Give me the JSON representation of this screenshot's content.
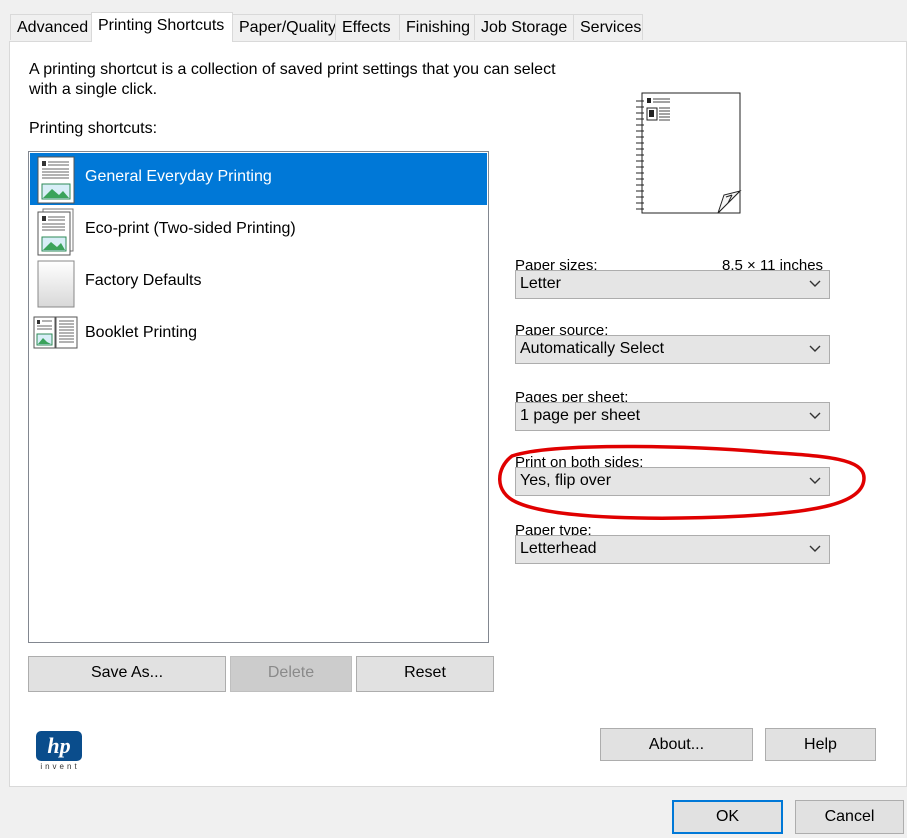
{
  "tabs": [
    "Advanced",
    "Printing Shortcuts",
    "Paper/Quality",
    "Effects",
    "Finishing",
    "Job Storage",
    "Services"
  ],
  "description": "A printing shortcut is a collection of saved print settings that you can select with a single click.",
  "shortcuts_label": "Printing shortcuts:",
  "shortcuts": [
    {
      "label": "General Everyday Printing",
      "icon": "document-icon",
      "selected": true
    },
    {
      "label": "Eco-print (Two-sided Printing)",
      "icon": "two-sided-document-icon",
      "selected": false
    },
    {
      "label": "Factory Defaults",
      "icon": "blank-page-icon",
      "selected": false
    },
    {
      "label": "Booklet Printing",
      "icon": "booklet-icon",
      "selected": false
    }
  ],
  "list_buttons": {
    "save_as": "Save As...",
    "delete": "Delete",
    "reset": "Reset"
  },
  "fields": {
    "paper_sizes": {
      "label": "Paper sizes:",
      "dims": "8.5 × 11 inches",
      "value": "Letter"
    },
    "paper_source": {
      "label": "Paper source:",
      "value": "Automatically Select"
    },
    "pages_per_sheet": {
      "label": "Pages per sheet:",
      "value": "1 page per sheet"
    },
    "print_both_sides": {
      "label": "Print on both sides:",
      "value": "Yes, flip over"
    },
    "paper_type": {
      "label": "Paper type:",
      "value": "Letterhead"
    }
  },
  "logo": {
    "text": "hp",
    "tagline": "invent",
    "color": "#0a4d8c"
  },
  "panel_buttons": {
    "about": "About...",
    "help": "Help"
  },
  "dialog_buttons": {
    "ok": "OK",
    "cancel": "Cancel"
  },
  "colors": {
    "selection": "#0078d7",
    "annotation": "#e00000"
  }
}
